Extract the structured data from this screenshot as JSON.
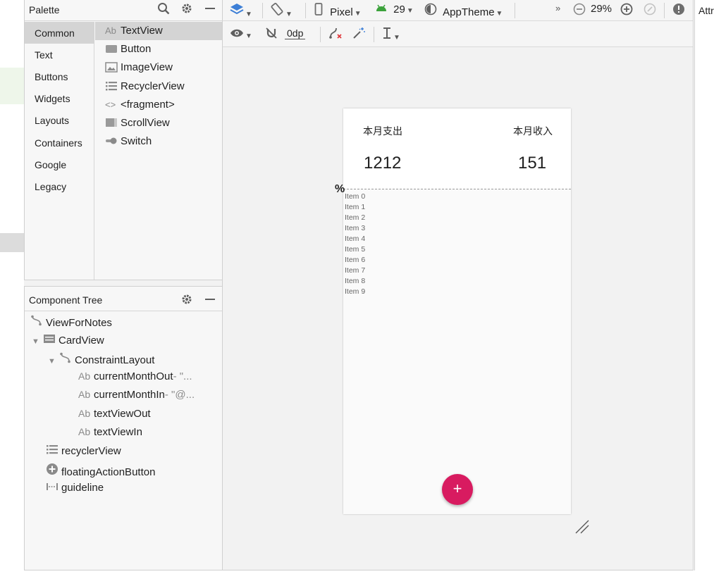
{
  "palette": {
    "title": "Palette",
    "categories": [
      "Common",
      "Text",
      "Buttons",
      "Widgets",
      "Layouts",
      "Containers",
      "Google",
      "Legacy"
    ],
    "selected_category": "Common",
    "widgets": [
      {
        "label": "TextView",
        "icon": "ab-text-icon",
        "icon_text": "Ab"
      },
      {
        "label": "Button",
        "icon": "button-icon"
      },
      {
        "label": "ImageView",
        "icon": "image-icon"
      },
      {
        "label": "RecyclerView",
        "icon": "list-icon"
      },
      {
        "label": "<fragment>",
        "icon": "code-brackets-icon",
        "icon_text": "<>"
      },
      {
        "label": "ScrollView",
        "icon": "scroll-view-icon"
      },
      {
        "label": "Switch",
        "icon": "switch-icon"
      }
    ]
  },
  "component_tree": {
    "title": "Component Tree",
    "nodes": [
      {
        "label": "ViewForNotes",
        "hint": "",
        "depth": 0,
        "icon": "constraint-layout-icon"
      },
      {
        "label": "CardView",
        "hint": "",
        "depth": 0,
        "icon": "card-view-icon",
        "expanded": true
      },
      {
        "label": "ConstraintLayout",
        "hint": "",
        "depth": 1,
        "icon": "constraint-layout-icon",
        "expanded": true
      },
      {
        "label": "currentMonthOut",
        "hint": "- \"...",
        "depth": 2,
        "icon": "ab-text-icon",
        "icon_text": "Ab"
      },
      {
        "label": "currentMonthIn",
        "hint": "- \"@...",
        "depth": 2,
        "icon": "ab-text-icon",
        "icon_text": "Ab"
      },
      {
        "label": "textViewOut",
        "hint": "",
        "depth": 2,
        "icon": "ab-text-icon",
        "icon_text": "Ab"
      },
      {
        "label": "textViewIn",
        "hint": "",
        "depth": 2,
        "icon": "ab-text-icon",
        "icon_text": "Ab"
      },
      {
        "label": "recyclerView",
        "hint": "",
        "depth": 0,
        "icon": "list-icon"
      },
      {
        "label": "floatingActionButton",
        "hint": "",
        "depth": 0,
        "icon": "fab-plus-icon"
      },
      {
        "label": "guideline",
        "hint": "",
        "depth": 0,
        "icon": "guideline-icon"
      }
    ]
  },
  "toolbar": {
    "device": "Pixel",
    "api_level": "29",
    "theme": "AppTheme",
    "zoom": "29%",
    "overflow": "»",
    "margin": "0dp"
  },
  "preview": {
    "label_out": "本月支出",
    "label_in": "本月收入",
    "value_out": "1212",
    "value_in": "151",
    "guideline_marker": "%",
    "items": [
      "Item 0",
      "Item 1",
      "Item 2",
      "Item 3",
      "Item 4",
      "Item 5",
      "Item 6",
      "Item 7",
      "Item 8",
      "Item 9"
    ],
    "fab_symbol": "+"
  },
  "attributes_panel": {
    "title": "Attr"
  },
  "colors": {
    "fab": "#d81b60",
    "selection": "#d4d4d4"
  }
}
